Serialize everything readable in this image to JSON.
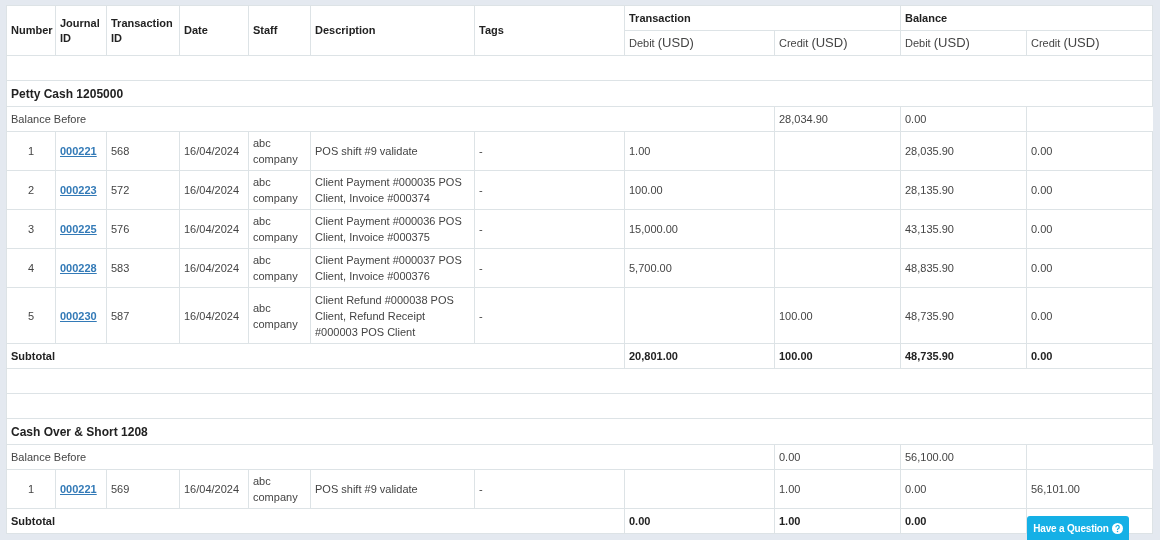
{
  "columns": {
    "number": "Number",
    "journal_id": "Journal ID",
    "transaction_id": "Transaction ID",
    "date": "Date",
    "staff": "Staff",
    "description": "Description",
    "tags": "Tags",
    "transaction": "Transaction",
    "balance": "Balance",
    "sub": [
      {
        "label": "Debit",
        "unit": "(USD)"
      },
      {
        "label": "Credit",
        "unit": "(USD)"
      },
      {
        "label": "Debit",
        "unit": "(USD)"
      },
      {
        "label": "Credit",
        "unit": "(USD)"
      }
    ]
  },
  "sections": [
    {
      "title": "Petty Cash 1205000",
      "balance_before": {
        "label": "Balance Before",
        "credit": "28,034.90",
        "balance_debit": "0.00"
      },
      "rows": [
        {
          "number": "1",
          "journal_id": "000221",
          "transaction_id": "568",
          "date": "16/04/2024",
          "staff": "abc company",
          "description": "POS shift #9 validate",
          "tags": "-",
          "debit": "1.00",
          "balance_debit": "28,035.90",
          "balance_credit": "0.00"
        },
        {
          "number": "2",
          "journal_id": "000223",
          "transaction_id": "572",
          "date": "16/04/2024",
          "staff": "abc company",
          "description": "Client Payment #000035 POS Client, Invoice #000374",
          "tags": "-",
          "debit": "100.00",
          "balance_debit": "28,135.90",
          "balance_credit": "0.00"
        },
        {
          "number": "3",
          "journal_id": "000225",
          "transaction_id": "576",
          "date": "16/04/2024",
          "staff": "abc company",
          "description": "Client Payment #000036 POS Client, Invoice #000375",
          "tags": "-",
          "debit": "15,000.00",
          "balance_debit": "43,135.90",
          "balance_credit": "0.00"
        },
        {
          "number": "4",
          "journal_id": "000228",
          "transaction_id": "583",
          "date": "16/04/2024",
          "staff": "abc company",
          "description": "Client Payment #000037 POS Client, Invoice #000376",
          "tags": "-",
          "debit": "5,700.00",
          "balance_debit": "48,835.90",
          "balance_credit": "0.00"
        },
        {
          "number": "5",
          "journal_id": "000230",
          "transaction_id": "587",
          "date": "16/04/2024",
          "staff": "abc company",
          "description": "Client Refund #000038 POS Client, Refund Receipt #000003 POS Client",
          "tags": "-",
          "credit": "100.00",
          "balance_debit": "48,735.90",
          "balance_credit": "0.00"
        }
      ],
      "subtotal": {
        "label": "Subtotal",
        "debit": "20,801.00",
        "credit": "100.00",
        "balance_debit": "48,735.90",
        "balance_credit": "0.00"
      }
    },
    {
      "title": "Cash Over & Short 1208",
      "balance_before": {
        "label": "Balance Before",
        "credit": "0.00",
        "balance_debit": "56,100.00"
      },
      "rows": [
        {
          "number": "1",
          "journal_id": "000221",
          "transaction_id": "569",
          "date": "16/04/2024",
          "staff": "abc company",
          "description": "POS shift #9 validate",
          "tags": "-",
          "credit": "1.00",
          "balance_debit": "0.00",
          "balance_credit": "56,101.00"
        }
      ],
      "subtotal": {
        "label": "Subtotal",
        "debit": "0.00",
        "credit": "1.00",
        "balance_debit": "0.00"
      }
    }
  ],
  "help_button": "Have a Question"
}
